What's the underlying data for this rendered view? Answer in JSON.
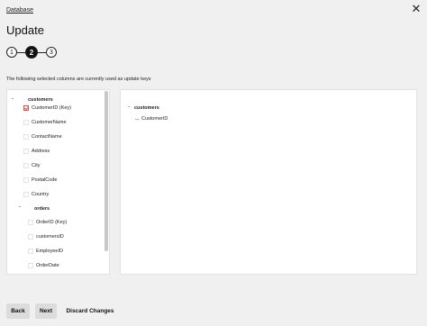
{
  "breadcrumb": "Database",
  "title": "Update",
  "steps": [
    "1",
    "2",
    "3"
  ],
  "active_step": "2",
  "description": "The following selected columns are currently used as update keys",
  "tree": {
    "customers": {
      "label": "customers",
      "columns": [
        {
          "label": "CustomerID (Key)",
          "checked": true
        },
        {
          "label": "CustomerName",
          "checked": false
        },
        {
          "label": "ContactName",
          "checked": false
        },
        {
          "label": "Address",
          "checked": false
        },
        {
          "label": "City",
          "checked": false
        },
        {
          "label": "PostalCode",
          "checked": false
        },
        {
          "label": "Country",
          "checked": false
        }
      ]
    },
    "orders": {
      "label": "orders",
      "columns": [
        {
          "label": "OrderID (Key)",
          "checked": false
        },
        {
          "label": "customersID",
          "checked": false
        },
        {
          "label": "EmployeeID",
          "checked": false
        },
        {
          "label": "OrderDate",
          "checked": false
        }
      ]
    }
  },
  "keys_panel": {
    "table": "customers",
    "key_icon": "key-icon",
    "key": "CustomerID"
  },
  "buttons": {
    "back": "Back",
    "next": "Next",
    "discard": "Discard Changes"
  },
  "colors": {
    "checkbox_checked": "#d9534f",
    "background": "#f0f0f0"
  }
}
